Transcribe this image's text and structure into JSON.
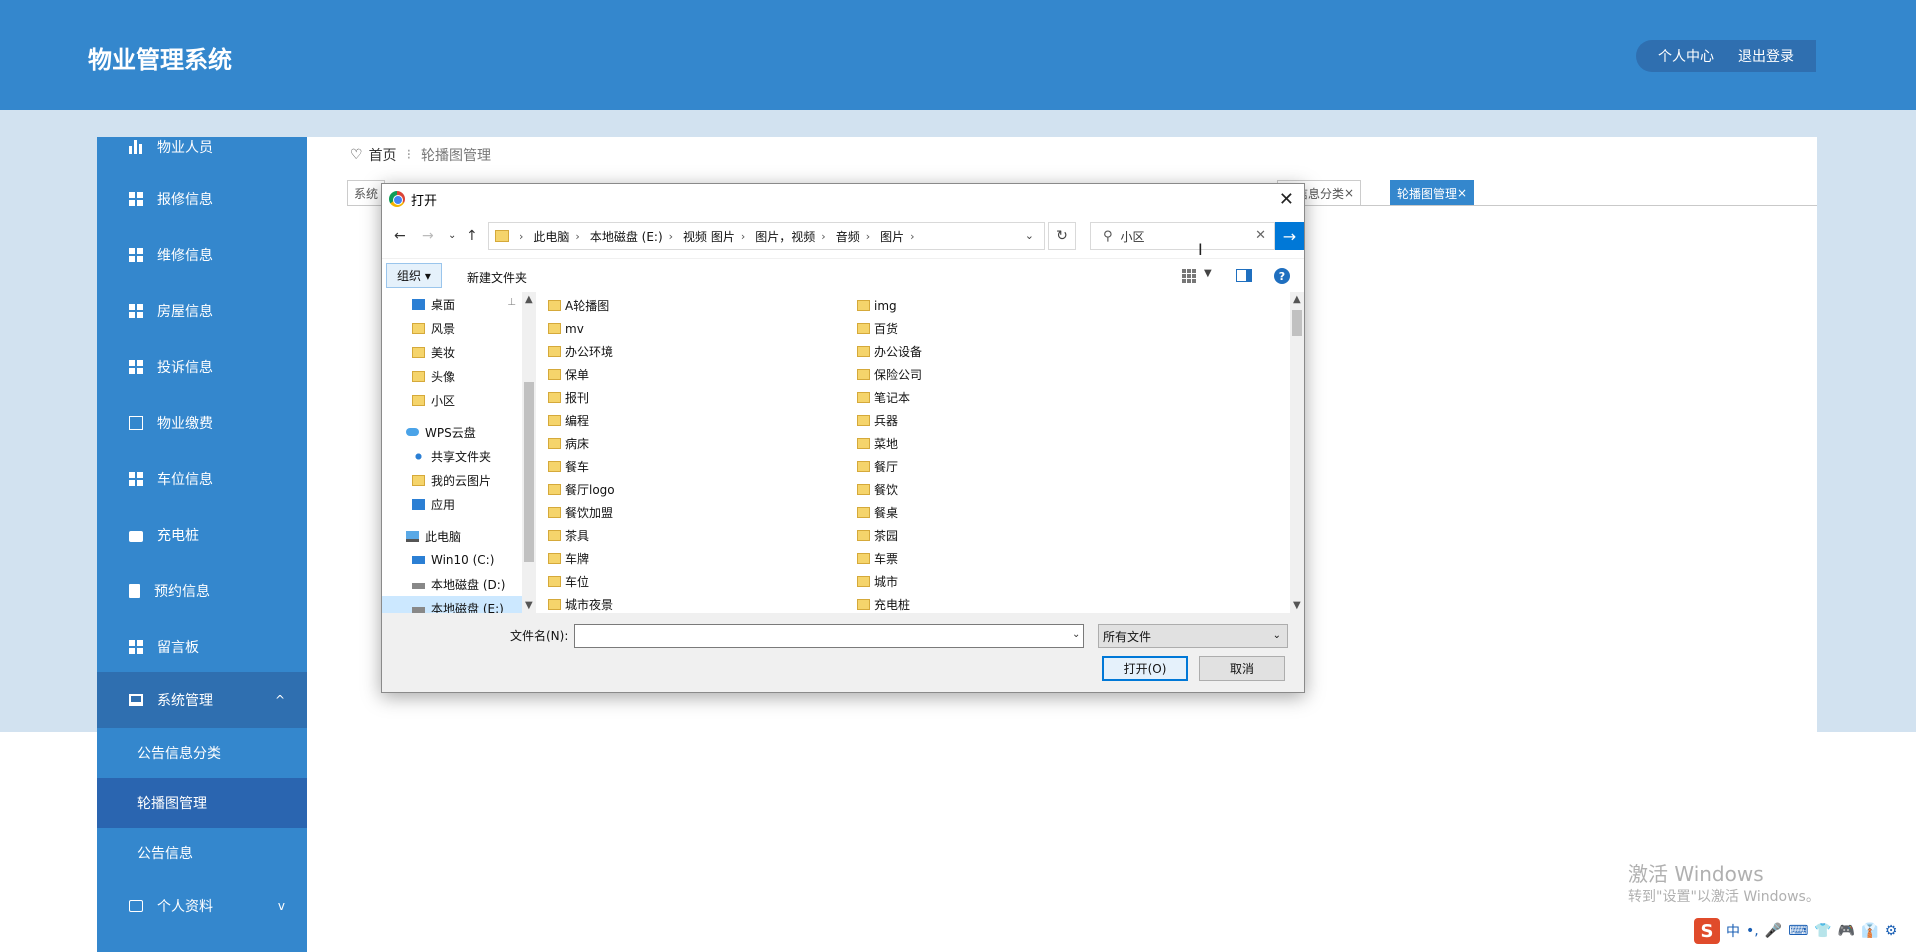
{
  "app": {
    "title": "物业管理系统",
    "top_actions": [
      "个人中心",
      "退出登录"
    ]
  },
  "sidebar": {
    "items": [
      {
        "label": "物业人员",
        "icon": "bar-chart-icon"
      },
      {
        "label": "报修信息",
        "icon": "grid-icon"
      },
      {
        "label": "维修信息",
        "icon": "grid-icon"
      },
      {
        "label": "房屋信息",
        "icon": "grid-icon"
      },
      {
        "label": "投诉信息",
        "icon": "grid-icon"
      },
      {
        "label": "物业缴费",
        "icon": "line-chart-icon"
      },
      {
        "label": "车位信息",
        "icon": "grid-icon"
      },
      {
        "label": "充电桩",
        "icon": "briefcase-icon"
      },
      {
        "label": "预约信息",
        "icon": "clipboard-icon"
      },
      {
        "label": "留言板",
        "icon": "grid-icon"
      },
      {
        "label": "系统管理",
        "icon": "monitor-icon",
        "chevron": "^"
      },
      {
        "label": "个人资料",
        "icon": "wallet-icon",
        "chevron": "v"
      }
    ],
    "sub_items": [
      "公告信息分类",
      "轮播图管理",
      "公告信息"
    ]
  },
  "breadcrumb": {
    "home": "首页",
    "separator": "⁝",
    "current": "轮播图管理"
  },
  "tabs": {
    "first": "系统",
    "notice": "告信息分类",
    "carousel": "轮播图管理",
    "close": "×"
  },
  "dialog": {
    "title": "打开",
    "close": "✕",
    "address": [
      "此电脑",
      "本地磁盘 (E:)",
      "视频 图片",
      "图片，视频",
      "音频",
      "图片"
    ],
    "search_value": "小区",
    "organize_label": "组织 ▾",
    "new_folder_label": "新建文件夹",
    "nav_items": [
      {
        "label": "桌面",
        "icon": "desktop-icon",
        "pin": "📌"
      },
      {
        "label": "风景",
        "icon": "folder-icon"
      },
      {
        "label": "美妆",
        "icon": "folder-icon"
      },
      {
        "label": "头像",
        "icon": "folder-icon"
      },
      {
        "label": "小区",
        "icon": "folder-icon"
      },
      {
        "label": "WPS云盘",
        "icon": "cloud-icon"
      },
      {
        "label": "共享文件夹",
        "icon": "share-icon"
      },
      {
        "label": "我的云图片",
        "icon": "folder-icon"
      },
      {
        "label": "应用",
        "icon": "apps-icon"
      },
      {
        "label": "此电脑",
        "icon": "computer-icon"
      },
      {
        "label": "Win10 (C:)",
        "icon": "windows-drive-icon"
      },
      {
        "label": "本地磁盘 (D:)",
        "icon": "drive-icon"
      },
      {
        "label": "本地磁盘 (E:)",
        "icon": "drive-icon"
      }
    ],
    "files_col1": [
      "A轮播图",
      "mv",
      "办公环境",
      "保单",
      "报刊",
      "编程",
      "病床",
      "餐车",
      "餐厅logo",
      "餐饮加盟",
      "茶具",
      "车牌",
      "车位",
      "城市夜景"
    ],
    "files_col2": [
      "img",
      "百货",
      "办公设备",
      "保险公司",
      "笔记本",
      "兵器",
      "菜地",
      "餐厅",
      "餐饮",
      "餐桌",
      "茶园",
      "车票",
      "城市",
      "充电桩"
    ],
    "filename_label": "文件名(N):",
    "filename_value": "",
    "filetype": "所有文件",
    "open_button": "打开(O)",
    "cancel_button": "取消"
  },
  "watermark": {
    "line1": "激活 Windows",
    "line2": "转到\"设置\"以激活 Windows。"
  },
  "ime": {
    "logo": "S",
    "items": [
      "中",
      "•,",
      "🎤",
      "⌨",
      "👕",
      "🎮",
      "👔",
      "⚙"
    ]
  }
}
